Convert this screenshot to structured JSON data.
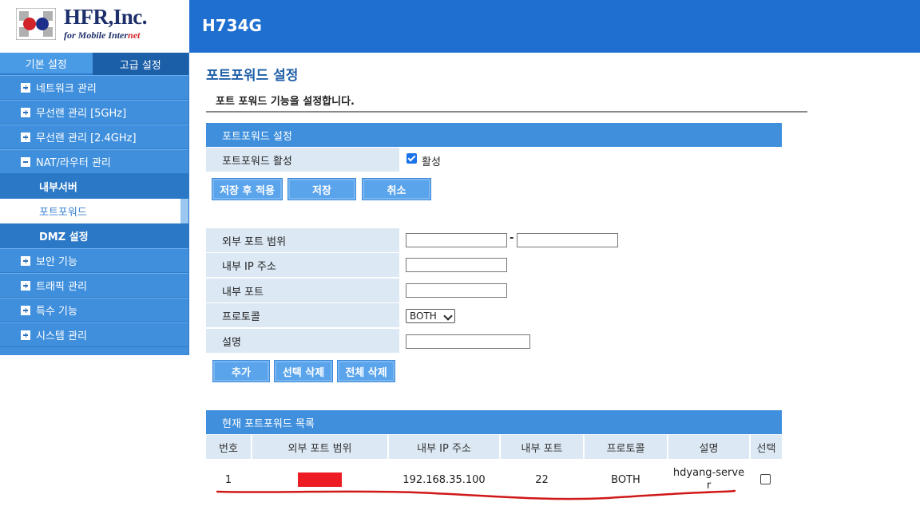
{
  "header": {
    "logo_name": "HFR,Inc.",
    "logo_tag_prefix": "for Mobile Inter",
    "logo_tag_suffix": "net",
    "model": "H734G",
    "colors": {
      "topbar": "#1e6fd0",
      "brand_red": "#d2232a",
      "brand_navy": "#1d2f6b"
    }
  },
  "sidebar": {
    "tabs": [
      {
        "label": "기본 설정",
        "active": true
      },
      {
        "label": "고급 설정",
        "active": false
      }
    ],
    "items": [
      {
        "label": "네트워크 관리",
        "icon": "plus-icon"
      },
      {
        "label": "무선랜 관리 [5GHz]",
        "icon": "plus-icon"
      },
      {
        "label": "무선랜 관리 [2.4GHz]",
        "icon": "plus-icon"
      },
      {
        "label": "NAT/라우터 관리",
        "icon": "minus-icon"
      }
    ],
    "subitems": [
      {
        "label": "내부서버",
        "selected": false
      },
      {
        "label": "포트포워드",
        "selected": true
      },
      {
        "label": "DMZ 설정",
        "selected": false
      }
    ],
    "items_after": [
      {
        "label": "보안 기능",
        "icon": "plus-icon"
      },
      {
        "label": "트래픽 관리",
        "icon": "plus-icon"
      },
      {
        "label": "특수 기능",
        "icon": "plus-icon"
      },
      {
        "label": "시스템 관리",
        "icon": "plus-icon"
      }
    ]
  },
  "main": {
    "title": "포트포워드 설정",
    "description": "포트 포워드 기능을 설정합니다.",
    "settings": {
      "header": "포트포워드 설정",
      "enable_label": "포트포워드 활성",
      "enable_checkbox_label": "활성",
      "enabled": true,
      "buttons": {
        "save_apply": "저장 후 적용",
        "save": "저장",
        "cancel": "취소"
      }
    },
    "form": {
      "external_port_range_label": "외부 포트 범위",
      "range_separator": "-",
      "external_port_start": "",
      "external_port_end": "",
      "internal_ip_label": "내부 IP 주소",
      "internal_ip": "",
      "internal_port_label": "내부 포트",
      "internal_port": "",
      "protocol_label": "프로토콜",
      "protocol_value": "BOTH",
      "description_label": "설명",
      "description": "",
      "buttons": {
        "add": "추가",
        "delete_selected": "선택 삭제",
        "delete_all": "전체 삭제"
      }
    },
    "list": {
      "header": "현재 포트포워드 목록",
      "columns": [
        "번호",
        "외부 포트 범위",
        "내부 IP 주소",
        "내부 포트",
        "프로토콜",
        "설명",
        "선택"
      ],
      "rows": [
        {
          "no": "1",
          "external_range": "",
          "internal_ip": "192.168.35.100",
          "internal_port": "22",
          "protocol": "BOTH",
          "description": "hdyang-server",
          "selected": false
        }
      ]
    },
    "annotation_colors": {
      "redaction": "#ed1c24",
      "underline": "#d01818"
    }
  }
}
